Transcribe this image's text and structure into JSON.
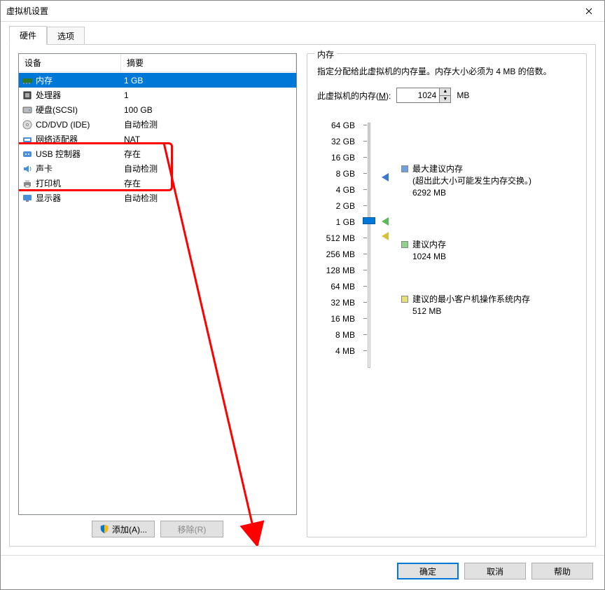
{
  "window": {
    "title": "虚拟机设置"
  },
  "tabs": {
    "hardware": "硬件",
    "options": "选项"
  },
  "deviceList": {
    "header": {
      "device": "设备",
      "summary": "摘要"
    },
    "rows": [
      {
        "icon": "memory",
        "name": "内存",
        "summary": "1 GB",
        "selected": true
      },
      {
        "icon": "cpu",
        "name": "处理器",
        "summary": "1",
        "selected": false
      },
      {
        "icon": "disk",
        "name": "硬盘(SCSI)",
        "summary": "100 GB",
        "selected": false
      },
      {
        "icon": "cd",
        "name": "CD/DVD (IDE)",
        "summary": "自动检测",
        "selected": false
      },
      {
        "icon": "network",
        "name": "网络适配器",
        "summary": "NAT",
        "selected": false
      },
      {
        "icon": "usb",
        "name": "USB 控制器",
        "summary": "存在",
        "selected": false
      },
      {
        "icon": "sound",
        "name": "声卡",
        "summary": "自动检测",
        "selected": false
      },
      {
        "icon": "printer",
        "name": "打印机",
        "summary": "存在",
        "selected": false
      },
      {
        "icon": "display",
        "name": "显示器",
        "summary": "自动检测",
        "selected": false
      }
    ]
  },
  "buttons": {
    "add": "添加(A)...",
    "remove": "移除(R)"
  },
  "memoryPanel": {
    "title": "内存",
    "desc": "指定分配给此虚拟机的内存量。内存大小必须为 4 MB 的倍数。",
    "inputLabelPrefix": "此虚拟机的内存(",
    "inputLabelKey": "M",
    "inputLabelSuffix": "):",
    "value": "1024",
    "unit": "MB",
    "ticks": [
      "64 GB",
      "32 GB",
      "16 GB",
      "8 GB",
      "4 GB",
      "2 GB",
      "1 GB",
      "512 MB",
      "256 MB",
      "128 MB",
      "64 MB",
      "32 MB",
      "16 MB",
      "8 MB",
      "4 MB"
    ],
    "legend": {
      "max": {
        "label": "最大建议内存",
        "note": "(超出此大小可能发生内存交换。)",
        "value": "6292 MB"
      },
      "rec": {
        "label": "建议内存",
        "value": "1024 MB"
      },
      "min": {
        "label": "建议的最小客户机操作系统内存",
        "value": "512 MB"
      }
    }
  },
  "footer": {
    "ok": "确定",
    "cancel": "取消",
    "help": "帮助"
  }
}
